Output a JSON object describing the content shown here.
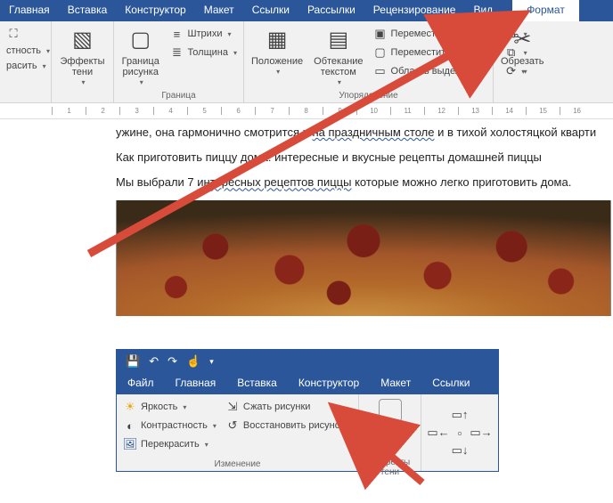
{
  "top": {
    "tabs": [
      "Главная",
      "Вставка",
      "Конструктор",
      "Макет",
      "Ссылки",
      "Рассылки",
      "Рецензирование",
      "Вид",
      "Формат"
    ],
    "active_tab_index": 8,
    "groups": {
      "partial_left": {
        "items": [
          "стность",
          "расить"
        ]
      },
      "effects": {
        "label": "Эффекты тени"
      },
      "border": {
        "label": "Граница",
        "picture_border": "Граница рисунка",
        "hatch": "Штрихи",
        "weight": "Толщина"
      },
      "arrange": {
        "label": "Упорядочение",
        "position": "Положение",
        "wrap": "Обтекание текстом",
        "bring_forward": "Переместить вперёд",
        "send_backward": "Переместить назад",
        "selection_pane": "Область выделения"
      },
      "crop": {
        "label": "Обрезать"
      }
    },
    "ruler_marks": [
      "",
      "1",
      "2",
      "3",
      "4",
      "5",
      "6",
      "7",
      "8",
      "9",
      "10",
      "11",
      "12",
      "13",
      "14",
      "15",
      "16"
    ],
    "doc": {
      "p1a": "ужине, она гармонично смотрится и ",
      "p1b": "на праздничным столе",
      "p1c": " и в тихой холостяцкой кварти",
      "p2": "Как приготовить пиццу дома: интересные и вкусные рецепты домашней пиццы",
      "p3a": "Мы выбрали 7 ",
      "p3b": "интересных рецептов пиццы",
      "p3c": " которые можно легко приготовить дома."
    }
  },
  "bottom": {
    "qat": {
      "save": "save",
      "undo": "undo",
      "redo": "redo",
      "touch": "touch"
    },
    "tabs": [
      "Файл",
      "Главная",
      "Вставка",
      "Конструктор",
      "Макет",
      "Ссылки"
    ],
    "groups": {
      "adjust": {
        "label": "Изменение",
        "brightness": "Яркость",
        "contrast": "Контрастность",
        "recolor": "Перекрасить",
        "compress": "Сжать рисунки",
        "reset": "Восстановить рисунок"
      },
      "shadow": {
        "label": "Эффекты тени",
        "effects": "Эффекты тени"
      }
    }
  }
}
